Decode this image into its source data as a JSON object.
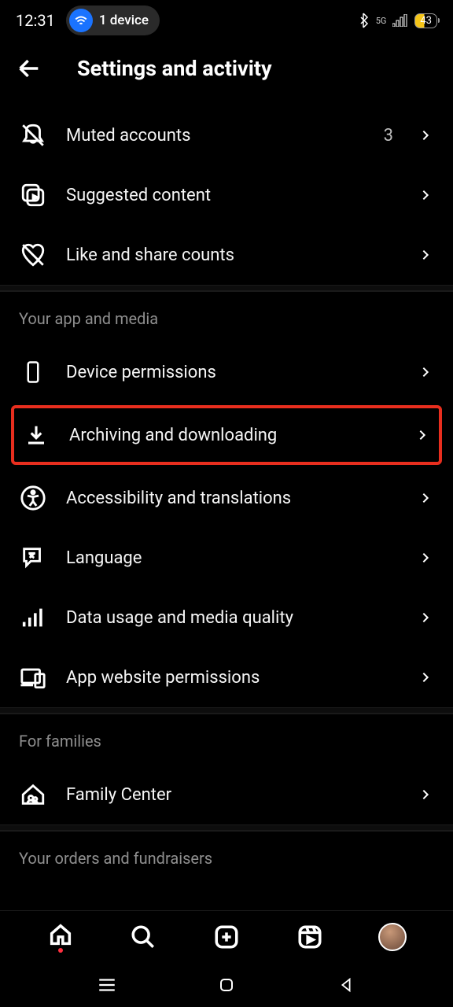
{
  "status_bar": {
    "time": "12:31",
    "device_count": "1 device",
    "battery": "43",
    "network": "5G"
  },
  "header": {
    "title": "Settings and activity"
  },
  "sections": {
    "top_items": [
      {
        "icon": "bell-muted",
        "label": "Muted accounts",
        "value": "3"
      },
      {
        "icon": "media-stack",
        "label": "Suggested content",
        "value": ""
      },
      {
        "icon": "heart-off",
        "label": "Like and share counts",
        "value": ""
      }
    ],
    "app_media": {
      "title": "Your app and media",
      "items": [
        {
          "icon": "phone",
          "label": "Device permissions"
        },
        {
          "icon": "download",
          "label": "Archiving and downloading",
          "highlighted": true
        },
        {
          "icon": "accessibility",
          "label": "Accessibility and translations"
        },
        {
          "icon": "language",
          "label": "Language"
        },
        {
          "icon": "signal-bars",
          "label": "Data usage and media quality"
        },
        {
          "icon": "devices",
          "label": "App website permissions"
        }
      ]
    },
    "families": {
      "title": "For families",
      "items": [
        {
          "icon": "family",
          "label": "Family Center"
        }
      ]
    },
    "orders": {
      "title": "Your orders and fundraisers"
    }
  }
}
